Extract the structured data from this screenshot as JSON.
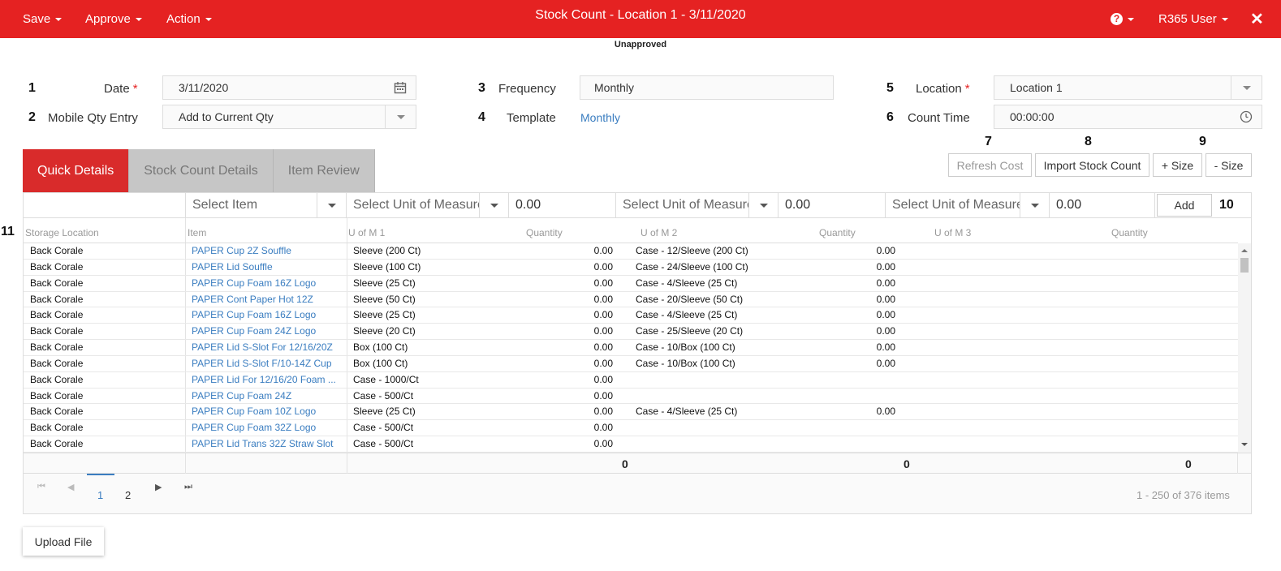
{
  "topbar": {
    "menus": [
      "Save",
      "Approve",
      "Action"
    ],
    "title": "Stock Count - Location 1 - 3/11/2020",
    "user": "R365 User",
    "close": "✕"
  },
  "status": "Unapproved",
  "form": {
    "date": {
      "num": "1",
      "label": "Date",
      "value": "3/11/2020"
    },
    "mobile": {
      "num": "2",
      "label": "Mobile Qty Entry",
      "value": "Add to Current Qty"
    },
    "frequency": {
      "num": "3",
      "label": "Frequency",
      "value": "Monthly"
    },
    "template": {
      "num": "4",
      "label": "Template",
      "value": "Monthly"
    },
    "location": {
      "num": "5",
      "label": "Location",
      "value": "Location 1"
    },
    "count_time": {
      "num": "6",
      "label": "Count Time",
      "value": "00:00:00"
    },
    "required_mark": "*"
  },
  "tabs": [
    "Quick Details",
    "Stock Count Details",
    "Item Review"
  ],
  "actions": {
    "refresh": {
      "num": "7",
      "label": "Refresh Cost"
    },
    "import": {
      "num": "8",
      "label": "Import Stock Count"
    },
    "plus": {
      "num": "9",
      "label": "+ Size"
    },
    "minus": {
      "label": "- Size"
    }
  },
  "quick_add": {
    "item_placeholder": "Select Item",
    "uom_placeholder": "Select Unit of Measure",
    "qty1": "0.00",
    "qty2": "0.00",
    "qty3": "0.00",
    "add": "Add",
    "add_num": "10",
    "grid_num": "11"
  },
  "columns": [
    "Storage Location",
    "Item",
    "U of M 1",
    "Quantity",
    "U of M 2",
    "Quantity",
    "U of M 3",
    "Quantity"
  ],
  "rows": [
    [
      "Back Corale",
      "PAPER Cup 2Z Souffle",
      "Sleeve (200 Ct)",
      "0.00",
      "Case - 12/Sleeve (200 Ct)",
      "0.00"
    ],
    [
      "Back Corale",
      "PAPER Lid Souffle",
      "Sleeve (100 Ct)",
      "0.00",
      "Case - 24/Sleeve (100 Ct)",
      "0.00"
    ],
    [
      "Back Corale",
      "PAPER Cup Foam 16Z Logo",
      "Sleeve (25 Ct)",
      "0.00",
      "Case - 4/Sleeve (25 Ct)",
      "0.00"
    ],
    [
      "Back Corale",
      "PAPER Cont Paper Hot 12Z",
      "Sleeve (50 Ct)",
      "0.00",
      "Case - 20/Sleeve (50 Ct)",
      "0.00"
    ],
    [
      "Back Corale",
      "PAPER Cup Foam 16Z Logo",
      "Sleeve (25 Ct)",
      "0.00",
      "Case - 4/Sleeve (25 Ct)",
      "0.00"
    ],
    [
      "Back Corale",
      "PAPER Cup Foam 24Z Logo",
      "Sleeve (20 Ct)",
      "0.00",
      "Case - 25/Sleeve (20 Ct)",
      "0.00"
    ],
    [
      "Back Corale",
      "PAPER Lid S-Slot For 12/16/20Z",
      "Box (100 Ct)",
      "0.00",
      "Case - 10/Box (100 Ct)",
      "0.00"
    ],
    [
      "Back Corale",
      "PAPER Lid S-Slot F/10-14Z Cup",
      "Box (100 Ct)",
      "0.00",
      "Case - 10/Box (100 Ct)",
      "0.00"
    ],
    [
      "Back Corale",
      "PAPER Lid For 12/16/20 Foam ...",
      "Case - 1000/Ct",
      "0.00",
      "",
      ""
    ],
    [
      "Back Corale",
      "PAPER Cup Foam 24Z",
      "Case - 500/Ct",
      "0.00",
      "",
      ""
    ],
    [
      "Back Corale",
      "PAPER Cup Foam 10Z Logo",
      "Sleeve (25 Ct)",
      "0.00",
      "Case - 4/Sleeve (25 Ct)",
      "0.00"
    ],
    [
      "Back Corale",
      "PAPER Cup Foam 32Z Logo",
      "Case - 500/Ct",
      "0.00",
      "",
      ""
    ],
    [
      "Back Corale",
      "PAPER Lid Trans 32Z Straw Slot",
      "Case - 500/Ct",
      "0.00",
      "",
      ""
    ]
  ],
  "totals": [
    "0",
    "0",
    "0"
  ],
  "pager": {
    "pages": [
      "1",
      "2"
    ],
    "summary": "1 - 250 of 376 items"
  },
  "upload": "Upload File",
  "colors": {
    "brand": "#e52222",
    "tab_active": "#d92b2b",
    "link": "#3a7dc0"
  }
}
